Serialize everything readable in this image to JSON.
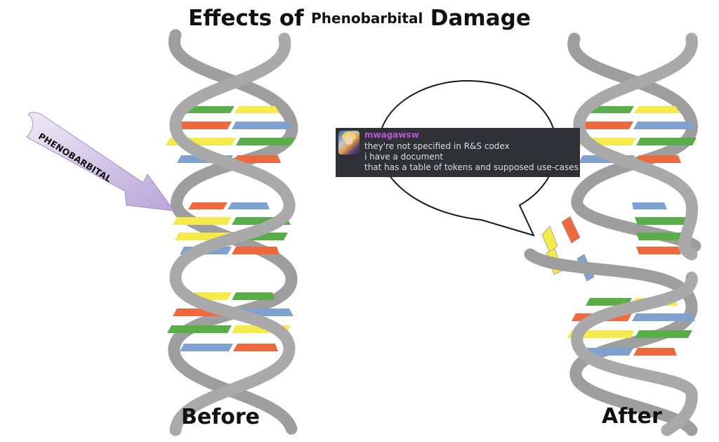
{
  "title": {
    "part1": "Effects of",
    "part2": "Phenobarbital",
    "part3": "Damage"
  },
  "arrow_label": "PHENOBARBITAL",
  "captions": {
    "before": "Before",
    "after": "After"
  },
  "chat": {
    "username": "mwagawsw",
    "lines": [
      "they're not specified in R&S codex",
      "i have a document",
      "that has a table of tokens and supposed use-cases"
    ]
  },
  "colors": {
    "backbone": "#a9a9a9",
    "green": "#5aae4a",
    "yellow": "#f4ea4a",
    "red": "#ee6a3e",
    "blue": "#7fa2d0",
    "arrow": "#c4b3dd",
    "chat_bg": "#2f3136",
    "username": "#b25ad0"
  }
}
